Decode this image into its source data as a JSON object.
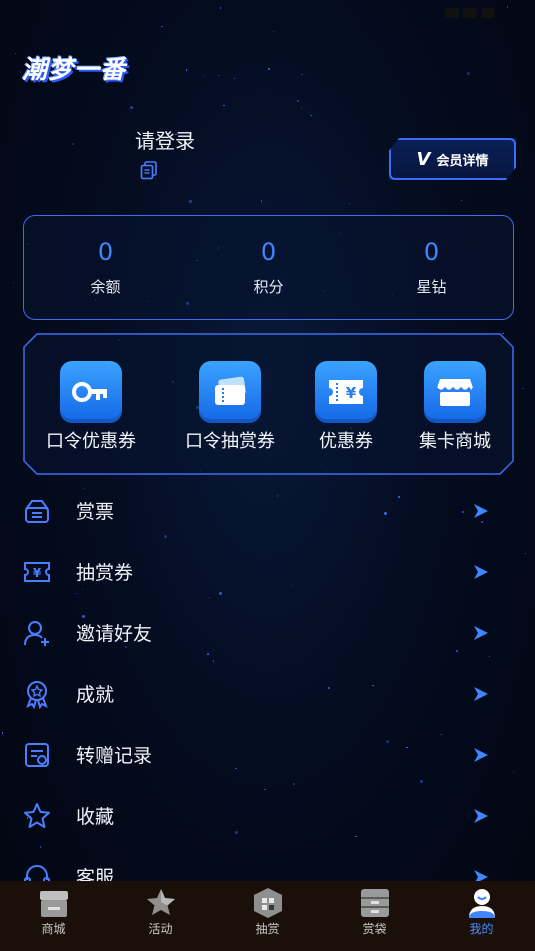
{
  "app": {
    "logo_text": "潮梦一番"
  },
  "status_bar": {
    "time": ""
  },
  "profile": {
    "login_prompt": "请登录",
    "vip_badge_letter": "V",
    "vip_button_label": "会员详情"
  },
  "stats": [
    {
      "value": "0",
      "label": "余额"
    },
    {
      "value": "0",
      "label": "积分"
    },
    {
      "value": "0",
      "label": "星钻"
    }
  ],
  "tools": [
    {
      "label": "口令优惠券",
      "icon": "key-icon"
    },
    {
      "label": "口令抽赏券",
      "icon": "ticket-stack-icon"
    },
    {
      "label": "优惠券",
      "icon": "yen-ticket-icon"
    },
    {
      "label": "集卡商城",
      "icon": "store-icon"
    }
  ],
  "menu": [
    {
      "label": "赏票",
      "icon": "ticket-bag-icon"
    },
    {
      "label": "抽赏券",
      "icon": "yen-coupon-icon"
    },
    {
      "label": "邀请好友",
      "icon": "add-user-icon"
    },
    {
      "label": "成就",
      "icon": "medal-icon"
    },
    {
      "label": "转赠记录",
      "icon": "record-icon"
    },
    {
      "label": "收藏",
      "icon": "star-icon"
    },
    {
      "label": "客服",
      "icon": "headset-icon"
    }
  ],
  "tabbar": [
    {
      "label": "商城",
      "icon": "shop-icon",
      "active": false
    },
    {
      "label": "活动",
      "icon": "activity-star-icon",
      "active": false
    },
    {
      "label": "抽赏",
      "icon": "draw-box-icon",
      "active": false
    },
    {
      "label": "赏袋",
      "icon": "bag-drawer-icon",
      "active": false
    },
    {
      "label": "我的",
      "icon": "profile-icon",
      "active": true
    }
  ],
  "colors": {
    "accent": "#3f86ff",
    "card_border": "#3f6df0",
    "tab_bg": "#1a1009",
    "tab_active": "#4a8dff"
  }
}
